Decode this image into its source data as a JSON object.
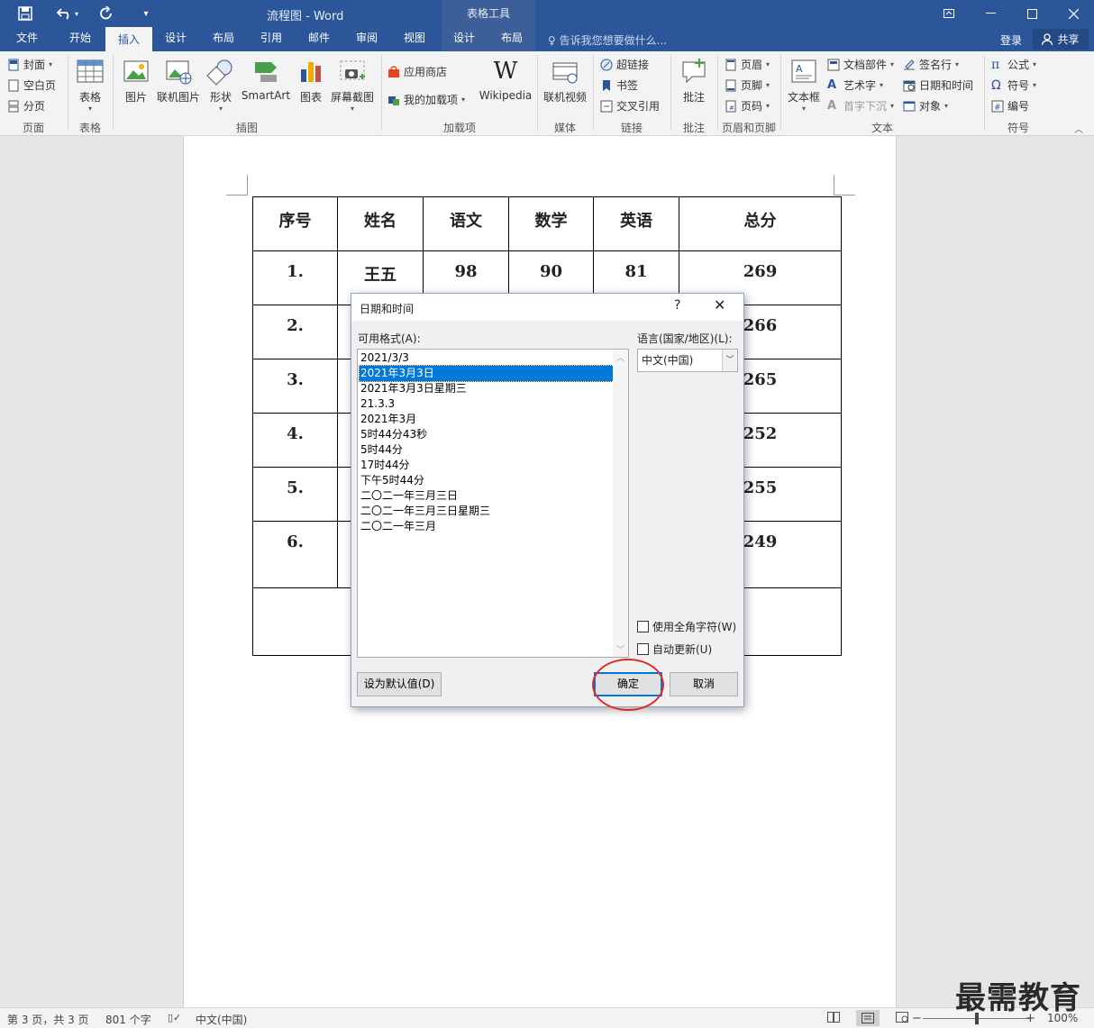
{
  "titlebar": {
    "doc_title": "流程图 - Word",
    "context_tab_group": "表格工具",
    "qat": {
      "save": "save-icon",
      "undo": "undo-icon",
      "redo": "redo-icon",
      "customize": "customize-icon"
    }
  },
  "tabs": [
    {
      "label": "文件"
    },
    {
      "label": "开始"
    },
    {
      "label": "插入",
      "active": true
    },
    {
      "label": "设计"
    },
    {
      "label": "布局"
    },
    {
      "label": "引用"
    },
    {
      "label": "邮件"
    },
    {
      "label": "审阅"
    },
    {
      "label": "视图"
    },
    {
      "label": "设计"
    },
    {
      "label": "布局"
    }
  ],
  "tell_me": "告诉我您想要做什么...",
  "login": "登录",
  "share": "共享",
  "ribbon": {
    "pages": {
      "label": "页面",
      "cover": "封面",
      "blank": "空白页",
      "break": "分页"
    },
    "tables": {
      "label": "表格",
      "table": "表格"
    },
    "illustrations": {
      "label": "插图",
      "picture": "图片",
      "online_picture": "联机图片",
      "shapes": "形状",
      "smartart": "SmartArt",
      "chart": "图表",
      "screenshot": "屏幕截图"
    },
    "addins": {
      "label": "加载项",
      "store": "应用商店",
      "my_addins": "我的加载项",
      "wikipedia": "Wikipedia"
    },
    "media": {
      "label": "媒体",
      "online_video": "联机视频"
    },
    "links": {
      "label": "链接",
      "hyperlink": "超链接",
      "bookmark": "书签",
      "crossref": "交叉引用"
    },
    "comments": {
      "label": "批注",
      "comment": "批注"
    },
    "header_footer": {
      "label": "页眉和页脚",
      "header": "页眉",
      "footer": "页脚",
      "page_number": "页码"
    },
    "text": {
      "label": "文本",
      "textbox": "文本框",
      "quick_parts": "文档部件",
      "wordart": "艺术字",
      "dropcap": "首字下沉",
      "signature": "签名行",
      "datetime": "日期和时间",
      "object": "对象"
    },
    "symbols": {
      "label": "符号",
      "equation": "公式",
      "symbol": "符号",
      "number": "编号"
    }
  },
  "table": {
    "headers": [
      "序号",
      "姓名",
      "语文",
      "数学",
      "英语",
      "总分"
    ],
    "rows": [
      [
        "1.",
        "王五",
        "98",
        "90",
        "81",
        "269"
      ],
      [
        "2.",
        "",
        "",
        "",
        "",
        "266"
      ],
      [
        "3.",
        "",
        "",
        "",
        "",
        "265"
      ],
      [
        "4.",
        "",
        "",
        "",
        "",
        "252"
      ],
      [
        "5.",
        "",
        "",
        "",
        "",
        "255"
      ],
      [
        "6.",
        "",
        "",
        "",
        "",
        "249"
      ]
    ]
  },
  "dialog": {
    "title": "日期和时间",
    "help": "?",
    "close": "✕",
    "formats_label": "可用格式(A):",
    "formats": [
      "2021/3/3",
      "2021年3月3日",
      "2021年3月3日星期三",
      "21.3.3",
      "2021年3月",
      "5时44分43秒",
      "5时44分",
      "17时44分",
      "下午5时44分",
      "二〇二一年三月三日",
      "二〇二一年三月三日星期三",
      "二〇二一年三月"
    ],
    "selected_index": 1,
    "language_label": "语言(国家/地区)(L):",
    "language_value": "中文(中国)",
    "fullwidth_label": "使用全角字符(W)",
    "autoupdate_label": "自动更新(U)",
    "set_default": "设为默认值(D)",
    "ok": "确定",
    "cancel": "取消"
  },
  "statusbar": {
    "page": "第 3 页，共 3 页",
    "words": "801 个字",
    "language": "中文(中国)",
    "zoom": "100%"
  },
  "watermark": "最需教育",
  "colors": {
    "brand": "#2b579a",
    "selection": "#0078d7",
    "highlight_circle": "#e02a2a"
  }
}
